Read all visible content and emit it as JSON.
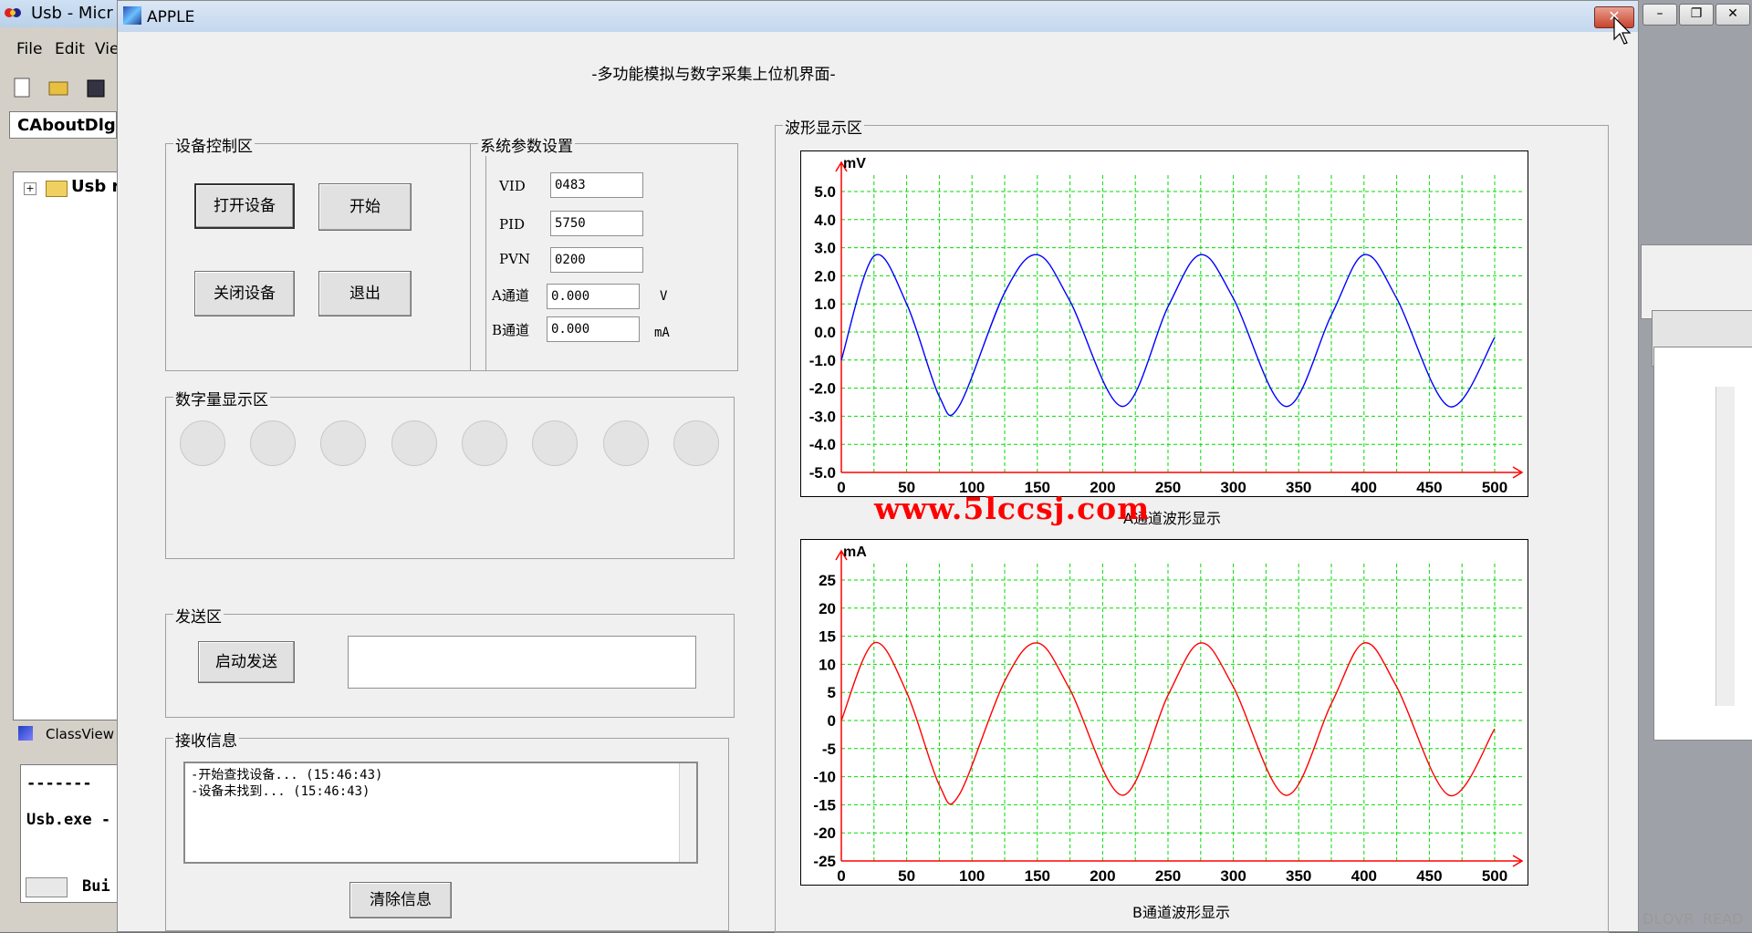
{
  "ide": {
    "title": "Usb - Micr",
    "menu": [
      "File",
      "Edit",
      "Vie"
    ],
    "combo_value": "CAboutDlg",
    "tree_item": "Usb r",
    "classview_tab": "ClassView",
    "output_dashes": "-------",
    "output_line": "Usb.exe -",
    "build_tab": "Bui",
    "status": [
      "DL",
      "OVR",
      "READ"
    ]
  },
  "dialog": {
    "title": "APPLE",
    "close_icon": "close-x-icon",
    "heading": "-多功能模拟与数字采集上位机界面-"
  },
  "device_control": {
    "label": "设备控制区",
    "open_button": "打开设备",
    "start_button": "开始",
    "close_button": "关闭设备",
    "exit_button": "退出"
  },
  "system_params": {
    "label": "系统参数设置",
    "vid_label": "VID",
    "vid_value": "0483",
    "pid_label": "PID",
    "pid_value": "5750",
    "pvn_label": "PVN",
    "pvn_value": "0200",
    "a_label": "A通道",
    "a_value": "0.000",
    "a_unit": "V",
    "b_label": "B通道",
    "b_value": "0.000",
    "b_unit": "mA"
  },
  "digital_display": {
    "label": "数字量显示区",
    "led_count": 8,
    "led_color": "#e3e3e3"
  },
  "send": {
    "label": "发送区",
    "button": "启动发送",
    "value": ""
  },
  "receive": {
    "label": "接收信息",
    "lines": [
      "-开始查找设备... (15:46:43)",
      "-设备未找到... (15:46:43)"
    ],
    "clear_button": "清除信息"
  },
  "waveform": {
    "label": "波形显示区",
    "watermark": "www.5lccsj.com",
    "grid_color": "#00dd00",
    "axis_color": "#ff0000"
  },
  "chart_data": [
    {
      "type": "line",
      "ylabel": "mV",
      "caption": "A通道波形显示",
      "xlim": [
        0,
        500
      ],
      "ylim": [
        -5,
        5
      ],
      "x_ticks": [
        "0",
        "50",
        "100",
        "150",
        "200",
        "250",
        "300",
        "350",
        "400",
        "450",
        "500"
      ],
      "y_ticks": [
        "5.0",
        "4.0",
        "3.0",
        "2.0",
        "1.0",
        "0.0",
        "-1.0",
        "-2.0",
        "-3.0",
        "-4.0",
        "-5.0"
      ],
      "series": [
        {
          "color": "#0000ff",
          "x": [
            0,
            25,
            50,
            75,
            90,
            125,
            150,
            175,
            215,
            250,
            275,
            300,
            340,
            375,
            400,
            425,
            465,
            500
          ],
          "y": [
            -1.0,
            2.7,
            1.0,
            -2.3,
            -2.65,
            1.4,
            2.75,
            1.1,
            -2.65,
            0.9,
            2.75,
            1.2,
            -2.65,
            0.6,
            2.75,
            1.2,
            -2.65,
            -0.2
          ]
        }
      ]
    },
    {
      "type": "line",
      "ylabel": "mA",
      "caption": "B通道波形显示",
      "xlim": [
        0,
        500
      ],
      "ylim": [
        -25,
        25
      ],
      "x_ticks": [
        "0",
        "50",
        "100",
        "150",
        "200",
        "250",
        "300",
        "350",
        "400",
        "450",
        "500"
      ],
      "y_ticks": [
        "25",
        "20",
        "15",
        "10",
        "5",
        "0",
        "-5",
        "-10",
        "-15",
        "-20",
        "-25"
      ],
      "series": [
        {
          "color": "#ff0000",
          "x": [
            0,
            25,
            50,
            75,
            90,
            125,
            150,
            175,
            215,
            250,
            275,
            300,
            340,
            375,
            400,
            425,
            465,
            500
          ],
          "y": [
            0,
            13.8,
            5,
            -11.5,
            -13.3,
            7,
            13.8,
            5.5,
            -13.3,
            4.5,
            13.8,
            6,
            -13.3,
            3,
            13.8,
            6,
            -13.3,
            -1.5
          ]
        }
      ]
    }
  ]
}
